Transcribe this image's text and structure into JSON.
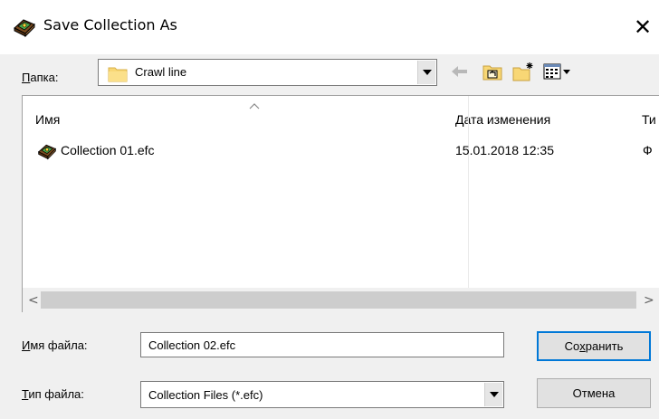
{
  "window": {
    "title": "Save Collection As",
    "close_symbol": "✕",
    "icon": "collection-book-icon"
  },
  "folder": {
    "label_underlined": "П",
    "label_rest": "апка:",
    "current": "Crawl line",
    "icon": "folder-icon"
  },
  "toolbar": {
    "back_icon": "back-arrow-icon",
    "up_icon": "up-folder-icon",
    "new_folder_icon": "new-folder-icon",
    "view_icon": "view-menu-icon"
  },
  "filelist": {
    "columns": {
      "name": "Имя",
      "date": "Дата изменения",
      "type": "Ти"
    },
    "rows": [
      {
        "name": "Collection 01.efc",
        "date": "15.01.2018 12:35",
        "type": "Ф"
      }
    ],
    "scroll_left": "<",
    "scroll_right": ">"
  },
  "filename": {
    "label_underlined": "И",
    "label_rest": "мя файла:",
    "value": "Collection 02.efc"
  },
  "filetype": {
    "label_underlined": "Т",
    "label_rest": "ип файла:",
    "value": "Collection Files (*.efc)"
  },
  "buttons": {
    "save_before": "Со",
    "save_underlined": "х",
    "save_after": "ранить",
    "cancel": "Отмена"
  },
  "colors": {
    "accent": "#0078d7",
    "folder_yellow": "#f8d775",
    "dialog_bg": "#f0f0f0"
  }
}
